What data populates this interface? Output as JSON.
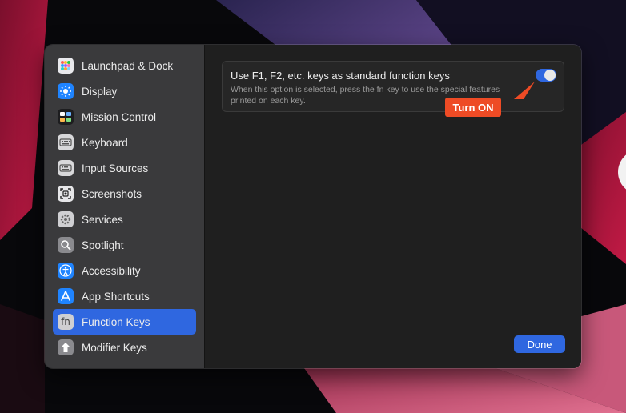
{
  "sidebar": {
    "items": [
      {
        "label": "Launchpad & Dock",
        "icon": "launchpad-icon"
      },
      {
        "label": "Display",
        "icon": "display-icon"
      },
      {
        "label": "Mission Control",
        "icon": "mission-control-icon"
      },
      {
        "label": "Keyboard",
        "icon": "keyboard-icon"
      },
      {
        "label": "Input Sources",
        "icon": "input-sources-icon"
      },
      {
        "label": "Screenshots",
        "icon": "screenshots-icon"
      },
      {
        "label": "Services",
        "icon": "services-gear-icon"
      },
      {
        "label": "Spotlight",
        "icon": "spotlight-magnifier-icon"
      },
      {
        "label": "Accessibility",
        "icon": "accessibility-icon"
      },
      {
        "label": "App Shortcuts",
        "icon": "app-shortcuts-icon"
      },
      {
        "label": "Function Keys",
        "icon": "function-keys-fn-icon",
        "selected": true
      },
      {
        "label": "Modifier Keys",
        "icon": "modifier-keys-arrow-icon"
      }
    ],
    "fn_glyph": "fn"
  },
  "option": {
    "title": "Use F1, F2, etc. keys as standard function keys",
    "description": "When this option is selected, press the fn key to use the special features printed on each key.",
    "toggle_on": true
  },
  "annotation": {
    "label": "Turn ON",
    "color": "#ee4b25"
  },
  "footer": {
    "done_label": "Done"
  },
  "colors": {
    "accent": "#2f67e0",
    "sidebar_bg": "#3a3a3c",
    "content_bg": "#1f1f1f"
  }
}
